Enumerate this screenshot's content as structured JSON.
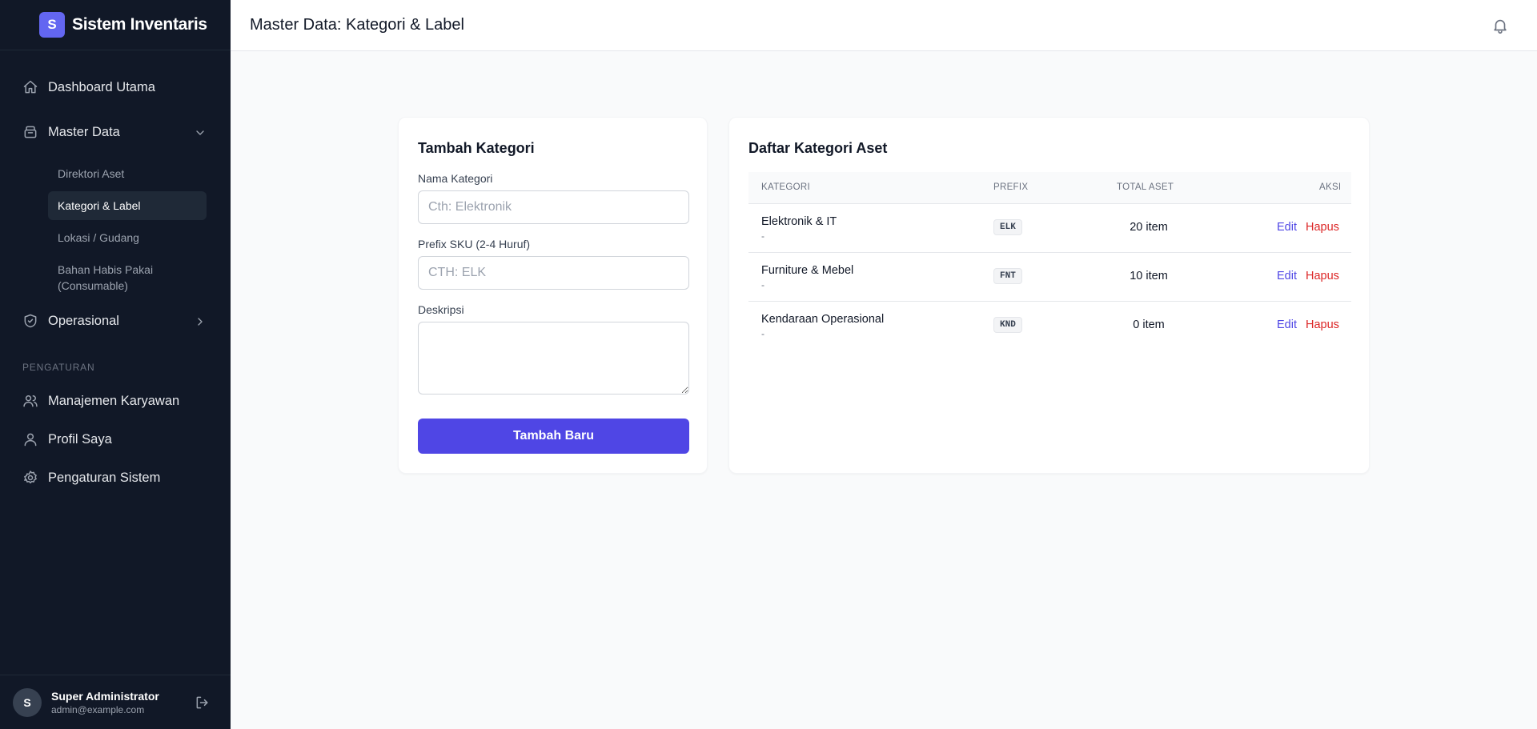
{
  "app": {
    "logo_letter": "S",
    "name": "Sistem Inventaris"
  },
  "sidebar": {
    "dashboard": "Dashboard Utama",
    "master_data": "Master Data",
    "master_items": [
      "Direktori Aset",
      "Kategori & Label",
      "Lokasi / Gudang",
      "Bahan Habis Pakai (Consumable)"
    ],
    "operasional": "Operasional",
    "section_pengaturan": "PENGATURAN",
    "karyawan": "Manajemen Karyawan",
    "profil": "Profil Saya",
    "pengaturan_sistem": "Pengaturan Sistem"
  },
  "user": {
    "initial": "S",
    "name": "Super Administrator",
    "email": "admin@example.com"
  },
  "header": {
    "title": "Master Data: Kategori & Label"
  },
  "form": {
    "title": "Tambah Kategori",
    "name_label": "Nama Kategori",
    "name_placeholder": "Cth: Elektronik",
    "prefix_label": "Prefix SKU (2-4 Huruf)",
    "prefix_placeholder": "CTH: ELK",
    "desc_label": "Deskripsi",
    "submit": "Tambah Baru"
  },
  "list": {
    "title": "Daftar Kategori Aset",
    "columns": [
      "KATEGORI",
      "PREFIX",
      "TOTAL ASET",
      "AKSI"
    ],
    "rows": [
      {
        "name": "Elektronik & IT",
        "desc": "-",
        "prefix": "ELK",
        "total": "20 item",
        "edit": "Edit",
        "delete": "Hapus"
      },
      {
        "name": "Furniture & Mebel",
        "desc": "-",
        "prefix": "FNT",
        "total": "10 item",
        "edit": "Edit",
        "delete": "Hapus"
      },
      {
        "name": "Kendaraan Operasional",
        "desc": "-",
        "prefix": "KND",
        "total": "0 item",
        "edit": "Edit",
        "delete": "Hapus"
      }
    ]
  },
  "colors": {
    "accent": "#4f46e5",
    "danger": "#dc2626",
    "sidebar_bg": "#111827"
  }
}
